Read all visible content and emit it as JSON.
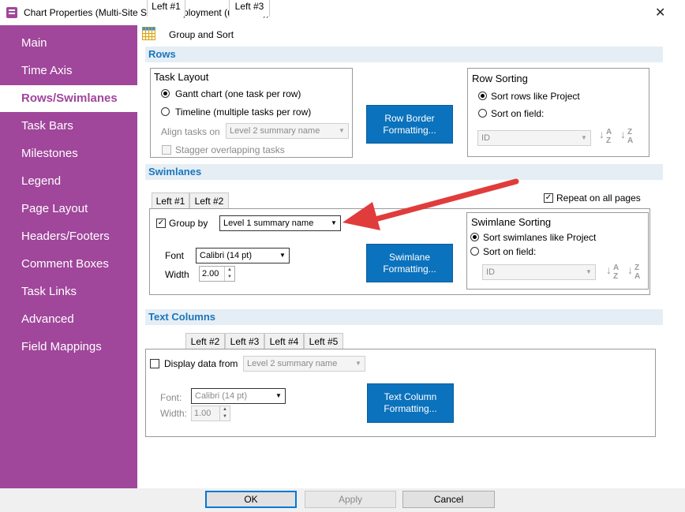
{
  "window": {
    "title": "Chart Properties (Multi-Site Server Deployment (unsaved))",
    "close_label": "✕"
  },
  "sidebar": {
    "items": [
      {
        "label": "Main"
      },
      {
        "label": "Time Axis"
      },
      {
        "label": "Rows/Swimlanes",
        "active": true
      },
      {
        "label": "Task Bars"
      },
      {
        "label": "Milestones"
      },
      {
        "label": "Legend"
      },
      {
        "label": "Page Layout"
      },
      {
        "label": "Headers/Footers"
      },
      {
        "label": "Comment Boxes"
      },
      {
        "label": "Task Links"
      },
      {
        "label": "Advanced"
      },
      {
        "label": "Field Mappings"
      }
    ],
    "colors": {
      "background": "#a0469b",
      "active_text": "#a0469b"
    }
  },
  "toolbar": {
    "group_sort_label": "Group and Sort",
    "icon": "grid-icon"
  },
  "rows": {
    "heading": "Rows",
    "task_layout": {
      "title": "Task Layout",
      "gantt_label": "Gantt chart (one task per row)",
      "timeline_label": "Timeline (multiple tasks per row)",
      "align_label": "Align tasks on",
      "align_value": "Level 2 summary name",
      "stagger_label": "Stagger overlapping tasks"
    },
    "border_button": "Row Border Formatting...",
    "row_sorting": {
      "title": "Row Sorting",
      "like_project_label": "Sort rows like Project",
      "on_field_label": "Sort on field:",
      "field_value": "ID"
    }
  },
  "swimlanes": {
    "heading": "Swimlanes",
    "tabs": [
      "Left #1",
      "Left #2",
      "Left #3"
    ],
    "repeat_label": "Repeat on all pages",
    "group_by_label": "Group by",
    "group_by_value": "Level 1 summary name",
    "font_label": "Font",
    "font_value": "Calibri (14 pt)",
    "width_label": "Width",
    "width_value": "2.00",
    "format_button": "Swimlane Formatting...",
    "sorting": {
      "title": "Swimlane Sorting",
      "like_project_label": "Sort swimlanes like Project",
      "on_field_label": "Sort on field:",
      "field_value": "ID"
    }
  },
  "text_columns": {
    "heading": "Text Columns",
    "tabs": [
      "Left #1",
      "Left #2",
      "Left #3",
      "Left #4",
      "Left #5"
    ],
    "display_label": "Display data from",
    "display_value": "Level 2 summary name",
    "font_label": "Font:",
    "font_value": "Calibri (14 pt)",
    "width_label": "Width:",
    "width_value": "1.00",
    "format_button": "Text Column Formatting..."
  },
  "footer": {
    "ok": "OK",
    "apply": "Apply",
    "cancel": "Cancel"
  },
  "annotation": {
    "arrow_color": "#e03c3c"
  }
}
